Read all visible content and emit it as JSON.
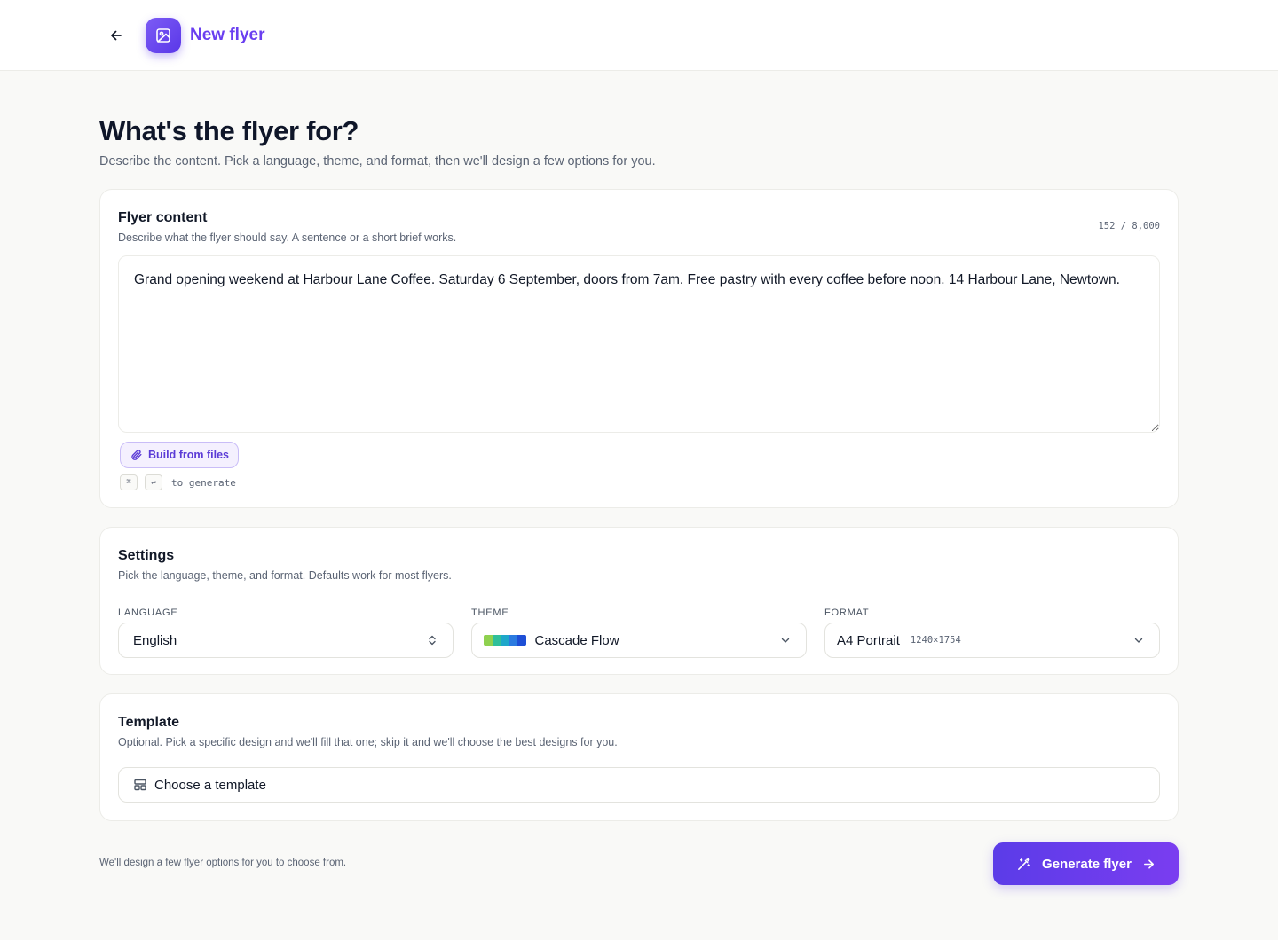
{
  "header": {
    "title": "New flyer",
    "back_icon": "arrow-left-icon",
    "app_icon": "image-icon",
    "accent_color": "#6a3ff0"
  },
  "page": {
    "title": "What's the flyer for?",
    "subtitle": "Describe the content. Pick a language, theme, and format, then we'll design a few options for you."
  },
  "content_card": {
    "title": "Flyer content",
    "description": "Describe what the flyer should say. A sentence or a short brief works.",
    "counter": "152 / 8,000",
    "text_value": "Grand opening weekend at Harbour Lane Coffee. Saturday 6 September, doors from 7am. Free pastry with every coffee before noon. 14 Harbour Lane, Newtown.",
    "files_button_label": "Build from files",
    "files_button_icon": "paperclip-icon",
    "shortcut_key1": "⌘",
    "shortcut_key2": "↵",
    "shortcut_text": "to generate"
  },
  "settings_card": {
    "title": "Settings",
    "description": "Pick the language, theme, and format. Defaults work for most flyers.",
    "language": {
      "label": "LANGUAGE",
      "value": "English",
      "icon": "chevron-up-down-icon"
    },
    "theme": {
      "label": "THEME",
      "value": "Cascade Flow",
      "icon": "chevron-down-icon",
      "swatch_colors": [
        "#8fd14f",
        "#2fbf9a",
        "#1ea7c9",
        "#2b7be0",
        "#1e4fd6"
      ]
    },
    "format": {
      "label": "FORMAT",
      "value": "A4 Portrait",
      "dims": "1240×1754",
      "icon": "chevron-down-icon"
    }
  },
  "template_card": {
    "title": "Template",
    "description": "Optional. Pick a specific design and we'll fill that one; skip it and we'll choose the best designs for you.",
    "button_label": "Choose a template",
    "button_icon": "layout-template-icon"
  },
  "footer": {
    "note": "We'll design a few flyer options for you to choose from.",
    "generate_label": "Generate flyer",
    "generate_icon": "magic-wand-icon",
    "arrow_icon": "arrow-right-icon"
  }
}
